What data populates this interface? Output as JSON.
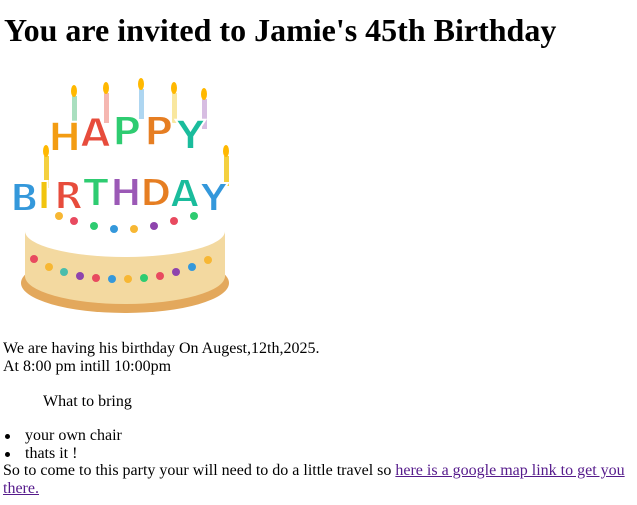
{
  "heading": "You are invited to Jamie's 45th Birthday",
  "image": {
    "topper_text_line1": "HAPPY",
    "topper_text_line2": "BIRTHDAY",
    "colors": {
      "cake_body": "#f3d9a0",
      "frosting": "#ffffff",
      "plate_edge": "#e3a85c",
      "flame": "#ffb800"
    }
  },
  "details": {
    "line1": "We are having his birthday On Augest,12th,2025.",
    "line2": "At 8:00 pm intill 10:00pm"
  },
  "what_to_bring": {
    "label": "What to bring",
    "items": [
      "your own chair",
      "thats it !"
    ]
  },
  "travel": {
    "text": "So to come to this party your will need to do a little travel so ",
    "link_text": "here is a google map link to get you there.",
    "link_color": "#551a8b"
  }
}
